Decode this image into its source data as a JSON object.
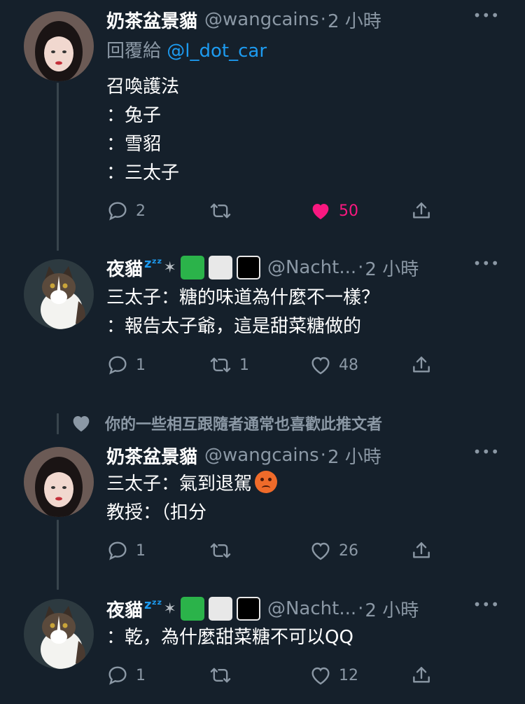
{
  "colors": {
    "background": "#15202b",
    "text": "#ffffff",
    "muted": "#8b98a5",
    "link": "#1d9bf0",
    "like": "#f91880"
  },
  "social_context": "你的一些相互跟隨者通常也喜歡此推文者",
  "tweets": [
    {
      "name": "奶茶盆景貓",
      "handle": "@wangcains",
      "separator": "·",
      "time": "2 小時",
      "more": "•••",
      "reply_prefix": "回覆給",
      "reply_mention": "@l_dot_car",
      "lines": [
        "召喚護法",
        "：兔子",
        "：雪貂",
        "：三太子"
      ],
      "replies": "2",
      "retweets": "",
      "likes": "50",
      "liked": true
    },
    {
      "name": "夜貓",
      "name_decoration": "zᶻᶻ",
      "handle": "@Nacht...",
      "separator": "·",
      "time": "2 小時",
      "more": "•••",
      "lines": [
        "三太子：糖的味道為什麼不一樣？",
        "：報告太子爺，這是甜菜糖做的"
      ],
      "replies": "1",
      "retweets": "1",
      "likes": "48"
    },
    {
      "name": "奶茶盆景貓",
      "handle": "@wangcains",
      "separator": "·",
      "time": "2 小時",
      "more": "•••",
      "lines": [
        "三太子：氣到退駕",
        "教授：（扣分"
      ],
      "replies": "1",
      "retweets": "",
      "likes": "26"
    },
    {
      "name": "夜貓",
      "name_decoration": "zᶻᶻ",
      "handle": "@Nacht...",
      "separator": "·",
      "time": "2 小時",
      "more": "•••",
      "lines": [
        "：乾，為什麼甜菜糖不可以QQ"
      ],
      "replies": "1",
      "retweets": "",
      "likes": "12"
    }
  ]
}
